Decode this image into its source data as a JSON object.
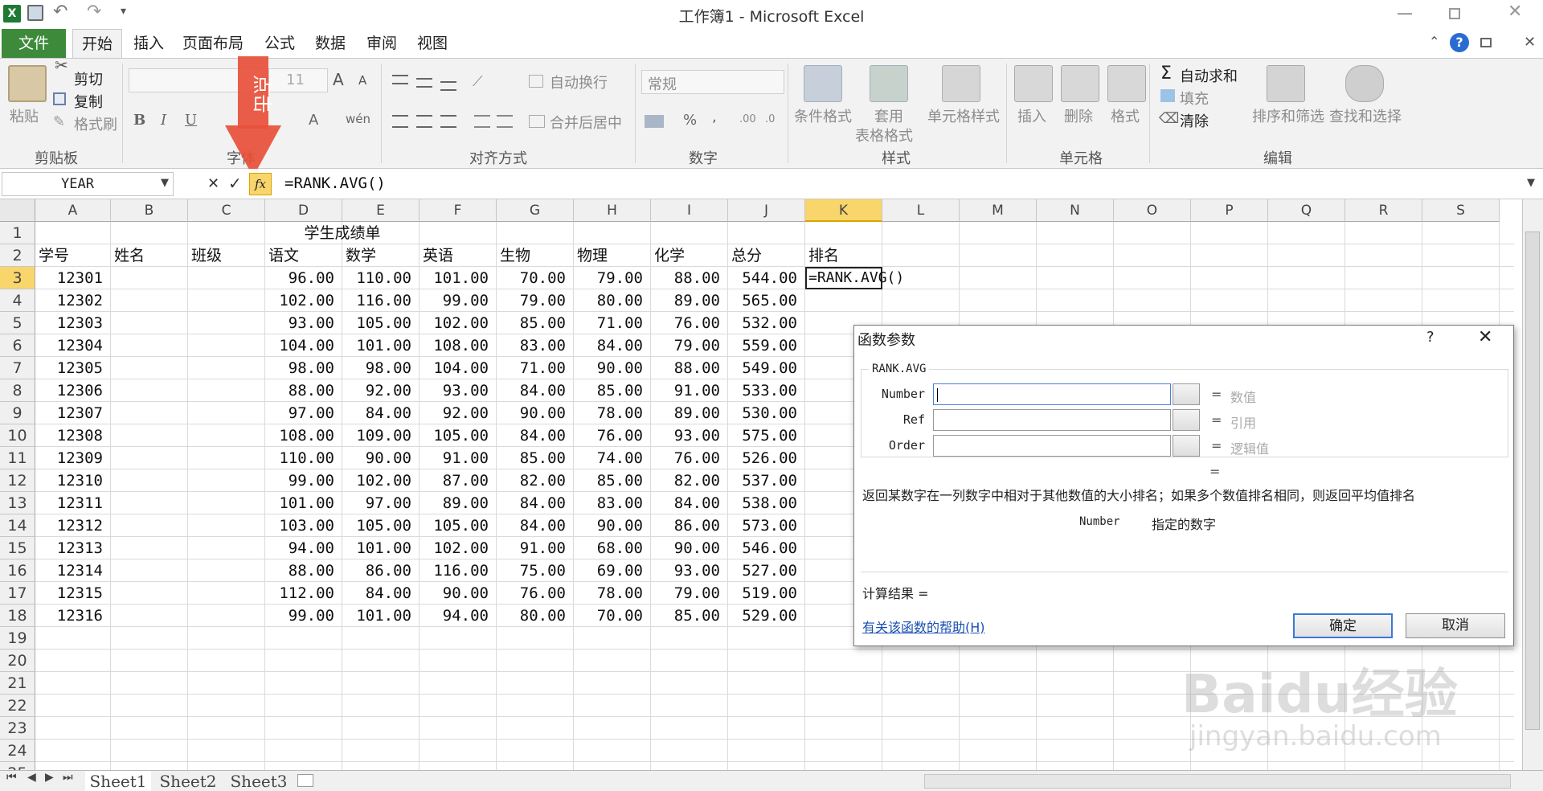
{
  "window": {
    "title": "工作簿1 - Microsoft Excel",
    "help_glyph": "?"
  },
  "ribbon_tabs": [
    "文件",
    "开始",
    "插入",
    "页面布局",
    "公式",
    "数据",
    "审阅",
    "视图"
  ],
  "ribbon": {
    "clipboard": {
      "paste": "粘贴",
      "cut": "剪切",
      "copy": "复制",
      "format_painter": "格式刷",
      "label": "剪贴板"
    },
    "font": {
      "size": "11",
      "bold": "B",
      "italic": "I",
      "underline": "U",
      "label": "字体",
      "grow": "A",
      "shrink": "A",
      "color_a": "A",
      "phonetic": "wén"
    },
    "alignment": {
      "wrap": "自动换行",
      "merge": "合并后居中",
      "label": "对齐方式"
    },
    "number": {
      "format": "常规",
      "percent": "%",
      "comma": ",",
      "label": "数字"
    },
    "styles": {
      "conditional": "条件格式",
      "table": "套用",
      "table2": "表格格式",
      "cell_style": "单元格样式",
      "label": "样式"
    },
    "cells": {
      "insert": "插入",
      "delete": "删除",
      "format": "格式",
      "label": "单元格"
    },
    "editing": {
      "autosum": "自动求和",
      "fill": "填充",
      "clear": "清除",
      "sort": "排序和筛选",
      "find": "查找和选择",
      "label": "编辑"
    }
  },
  "annotation": {
    "text": "点击"
  },
  "formula_bar": {
    "name_box": "YEAR",
    "formula": "=RANK.AVG()",
    "fx": "fx",
    "cancel": "✕",
    "enter": "✓"
  },
  "columns": [
    "A",
    "B",
    "C",
    "D",
    "E",
    "F",
    "G",
    "H",
    "I",
    "J",
    "K",
    "L",
    "M",
    "N",
    "O",
    "P",
    "Q",
    "R",
    "S"
  ],
  "rows": [
    "1",
    "2",
    "3",
    "4",
    "5",
    "6",
    "7",
    "8",
    "9",
    "10",
    "11",
    "12",
    "13",
    "14",
    "15",
    "16",
    "17",
    "18",
    "19",
    "20",
    "21",
    "22",
    "23",
    "24",
    "25"
  ],
  "sheet": {
    "title": "学生成绩单",
    "headers": [
      "学号",
      "姓名",
      "班级",
      "语文",
      "数学",
      "英语",
      "生物",
      "物理",
      "化学",
      "总分",
      "排名"
    ],
    "data": [
      [
        "12301",
        "96.00",
        "110.00",
        "101.00",
        "70.00",
        "79.00",
        "88.00",
        "544.00"
      ],
      [
        "12302",
        "102.00",
        "116.00",
        "99.00",
        "79.00",
        "80.00",
        "89.00",
        "565.00"
      ],
      [
        "12303",
        "93.00",
        "105.00",
        "102.00",
        "85.00",
        "71.00",
        "76.00",
        "532.00"
      ],
      [
        "12304",
        "104.00",
        "101.00",
        "108.00",
        "83.00",
        "84.00",
        "79.00",
        "559.00"
      ],
      [
        "12305",
        "98.00",
        "98.00",
        "104.00",
        "71.00",
        "90.00",
        "88.00",
        "549.00"
      ],
      [
        "12306",
        "88.00",
        "92.00",
        "93.00",
        "84.00",
        "85.00",
        "91.00",
        "533.00"
      ],
      [
        "12307",
        "97.00",
        "84.00",
        "92.00",
        "90.00",
        "78.00",
        "89.00",
        "530.00"
      ],
      [
        "12308",
        "108.00",
        "109.00",
        "105.00",
        "84.00",
        "76.00",
        "93.00",
        "575.00"
      ],
      [
        "12309",
        "110.00",
        "90.00",
        "91.00",
        "85.00",
        "74.00",
        "76.00",
        "526.00"
      ],
      [
        "12310",
        "99.00",
        "102.00",
        "87.00",
        "82.00",
        "85.00",
        "82.00",
        "537.00"
      ],
      [
        "12311",
        "101.00",
        "97.00",
        "89.00",
        "84.00",
        "83.00",
        "84.00",
        "538.00"
      ],
      [
        "12312",
        "103.00",
        "105.00",
        "105.00",
        "84.00",
        "90.00",
        "86.00",
        "573.00"
      ],
      [
        "12313",
        "94.00",
        "101.00",
        "102.00",
        "91.00",
        "68.00",
        "90.00",
        "546.00"
      ],
      [
        "12314",
        "88.00",
        "86.00",
        "116.00",
        "75.00",
        "69.00",
        "93.00",
        "527.00"
      ],
      [
        "12315",
        "112.00",
        "84.00",
        "90.00",
        "76.00",
        "78.00",
        "79.00",
        "519.00"
      ],
      [
        "12316",
        "99.00",
        "101.00",
        "94.00",
        "80.00",
        "70.00",
        "85.00",
        "529.00"
      ]
    ],
    "active_cell_content": "=RANK.AVG()"
  },
  "sheet_tabs": [
    "Sheet1",
    "Sheet2",
    "Sheet3"
  ],
  "dialog": {
    "title": "函数参数",
    "help": "?",
    "close": "✕",
    "function_name": "RANK.AVG",
    "args": [
      {
        "name": "Number",
        "value": "",
        "hint": "数值"
      },
      {
        "name": "Ref",
        "value": "",
        "hint": "引用"
      },
      {
        "name": "Order",
        "value": "",
        "hint": "逻辑值"
      }
    ],
    "eq": "=",
    "description": "返回某数字在一列数字中相对于其他数值的大小排名；如果多个数值排名相同，则返回平均值排名",
    "arg_desc_name": "Number",
    "arg_desc_text": "指定的数字",
    "result_label": "计算结果 =",
    "help_link": "有关该函数的帮助(H)",
    "ok": "确定",
    "cancel": "取消"
  },
  "watermark": {
    "text": "Baidu经验",
    "url": "jingyan.baidu.com"
  },
  "colors": {
    "accent_green": "#3d8a3a",
    "selected_col": "#f8d66c",
    "arrow": "#e8503a",
    "dialog_link": "#1a4fb4"
  }
}
